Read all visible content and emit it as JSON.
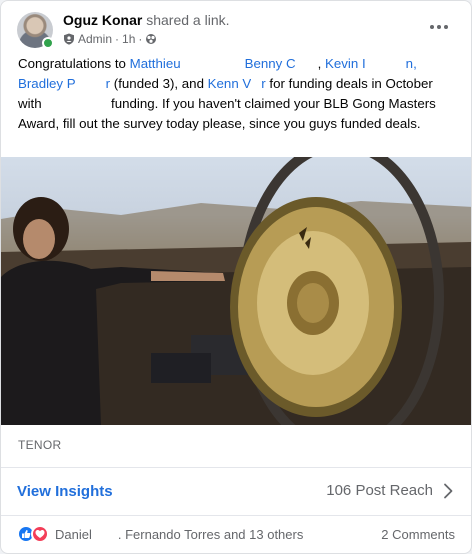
{
  "post": {
    "author": "Oguz Konar",
    "action": "shared a link.",
    "role": "Admin",
    "time": "1h",
    "more_label": "•••"
  },
  "text": {
    "p1": "Congratulations to ",
    "m1": "Matthieu",
    "m2": "Benny C",
    "m3": "Kevin I",
    "m3_tail": "n,",
    "m4": "Bradley P",
    "m4_tail": "r",
    "p2": " (funded 3), and ",
    "m5": "Kenn V",
    "m5_tail": "r",
    "p3": " for funding deals in October with ",
    "p4": " funding. If you haven't claimed your BLB Gong Masters Award, fill out the survey today please, since you guys funded deals."
  },
  "media": {
    "source_label": "TENOR"
  },
  "insights": {
    "link_label": "View Insights",
    "reach_label": "106 Post Reach"
  },
  "footer": {
    "reactors_a": "Daniel",
    "reactors_b": ". Fernando Torres and 13 others",
    "comments": "2 Comments"
  },
  "colors": {
    "link": "#216fdb",
    "online": "#31a24c",
    "like": "#1877f2",
    "love": "#f33e58"
  }
}
